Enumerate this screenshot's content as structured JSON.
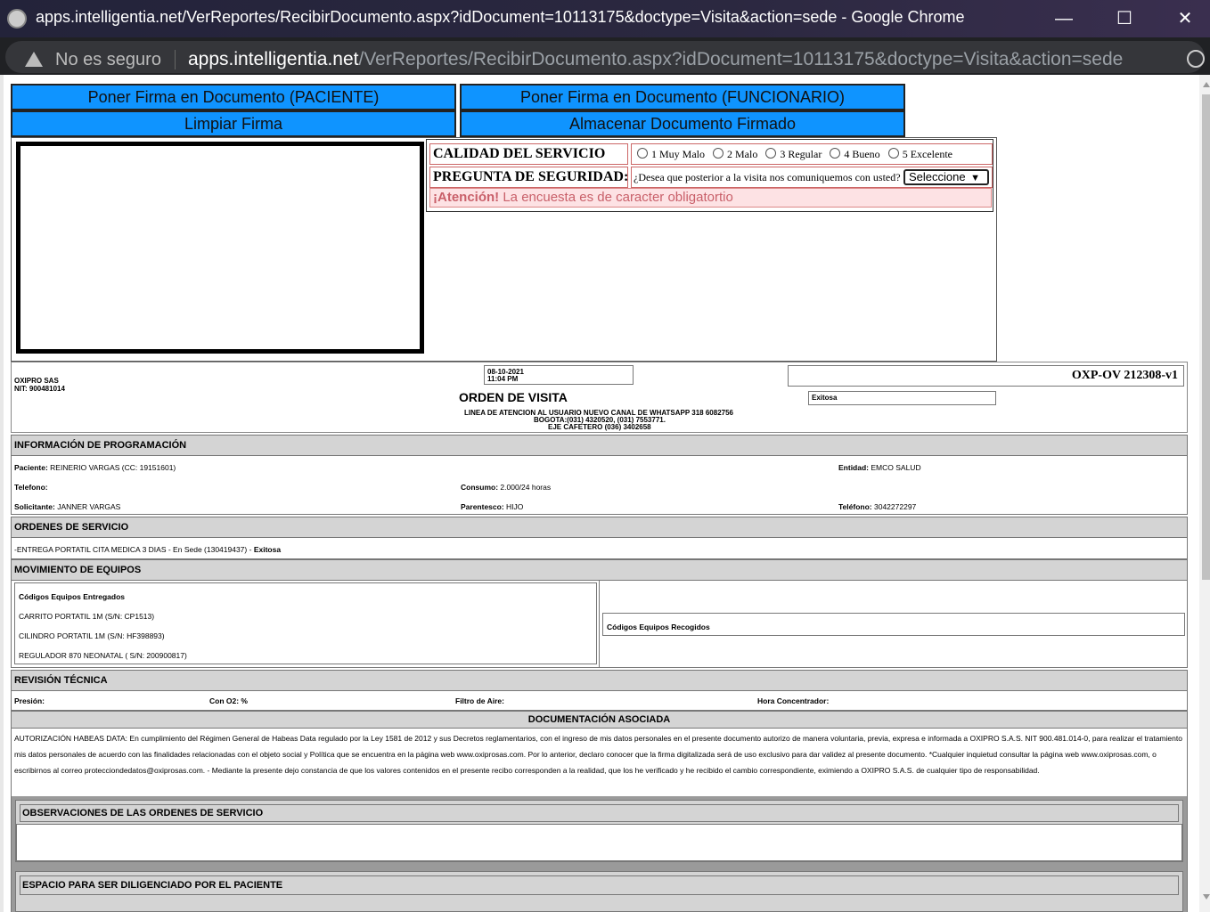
{
  "window": {
    "title": "apps.intelligentia.net/VerReportes/RecibirDocumento.aspx?idDocument=10113175&doctype=Visita&action=sede - Google Chrome",
    "minimize_icon": "minimize-icon",
    "maximize_icon": "maximize-icon",
    "close_icon": "close-icon"
  },
  "address": {
    "security_text": "No es seguro",
    "host": "apps.intelligentia.net",
    "path": "/VerReportes/RecibirDocumento.aspx?idDocument=10113175&doctype=Visita&action=sede"
  },
  "buttons": {
    "firma_paciente": "Poner Firma en Documento (PACIENTE)",
    "firma_funcionario": "Poner Firma en Documento (FUNCIONARIO)",
    "limpiar": "Limpiar Firma",
    "almacenar": "Almacenar Documento Firmado"
  },
  "survey": {
    "calidad_label": "CALIDAD DEL SERVICIO",
    "options": [
      "1 Muy Malo",
      "2 Malo",
      "3 Regular",
      "4 Bueno",
      "5 Excelente"
    ],
    "pregunta_label": "PREGUNTA DE SEGURIDAD:",
    "pregunta_text": "¿Desea que posterior a la visita nos comuniquemos con usted?",
    "select_value": "Seleccione",
    "alert_strong": "¡Atención!",
    "alert_text": " La encuesta es de caracter obligatortio"
  },
  "doc": {
    "company": "OXIPRO SAS",
    "nit": "NIT: 900481014",
    "date": "08-10-2021",
    "time": "11:04 PM",
    "title": "ORDEN DE VISITA",
    "line1": "LINEA DE ATENCION AL USUARIO NUEVO CANAL DE WHATSAPP 318 6082756",
    "line2": "BOGOTA:(031) 4320520, (031) 7553771.",
    "line3": "EJE CAFETERO (036) 3402658",
    "code": "OXP-OV 212308-v1",
    "status": "Exitosa"
  },
  "prog": {
    "header": "INFORMACIÓN DE PROGRAMACIÓN",
    "paciente_label": "Paciente:",
    "paciente": "REINERIO VARGAS (CC: 19151601)",
    "entidad_label": "Entidad:",
    "entidad": "EMCO SALUD",
    "telefono_label": "Telefono:",
    "consumo_label": "Consumo:",
    "consumo": "2.000/24 horas",
    "solicitante_label": "Solicitante:",
    "solicitante": "JANNER VARGAS",
    "parentesco_label": "Parentesco:",
    "parentesco": "HIJO",
    "telefono2_label": "Teléfono:",
    "telefono2": "3042272297"
  },
  "ordenes": {
    "header": "ORDENES DE SERVICIO",
    "item": "-ENTREGA PORTATIL CITA MEDICA 3 DIAS - En Sede (130419437)",
    "dash": "-",
    "status": "Exitosa"
  },
  "equipos": {
    "header": "MOVIMIENTO DE EQUIPOS",
    "entregados_label": "Códigos Equipos Entregados",
    "entregados": [
      "CARRITO PORTATIL 1M (S/N: CP1513)",
      "CILINDRO PORTATIL 1M (S/N: HF398893)",
      "REGULADOR 870 NEONATAL ( S/N: 200900817)"
    ],
    "recogidos_label": "Códigos Equipos Recogidos"
  },
  "revision": {
    "header": "REVISIÓN TÉCNICA",
    "presion": "Presión:",
    "con_o2": "Con O2: %",
    "filtro": "Filtro de Aire:",
    "hora": "Hora Concentrador:"
  },
  "documentacion": {
    "header": "DOCUMENTACIÓN ASOCIADA",
    "habeas": "AUTORIZACIÓN HABEAS DATA: En cumplimiento del Régimen General de Habeas Data regulado por la Ley 1581 de 2012 y sus Decretos reglamentarios, con el ingreso de mis datos personales en el presente documento autorizo de manera voluntaria, previa, expresa e informada a OXIPRO S.A.S. NIT 900.481.014-0, para realizar el tratamiento mis datos personales de acuerdo con las finalidades relacionadas con el objeto social y Política que se encuentra en la página web www.oxiprosas.com. Por lo anterior, declaro conocer que la firma digitalizada será de uso exclusivo para dar validez al presente documento. *Cualquier inquietud consultar la página web www.oxiprosas.com, o escribirnos al correo protecciondedatos@oxiprosas.com. - Mediante la presente dejo constancia de que los valores contenidos en el presente recibo corresponden a la realidad, que los he verificado y he recibido el cambio correspondiente, eximiendo a OXIPRO S.A.S. de cualquier tipo de responsabilidad."
  },
  "observaciones": {
    "header": "OBSERVACIONES DE LAS ORDENES DE SERVICIO"
  },
  "paciente_space": {
    "header": "ESPACIO PARA SER DILIGENCIADO POR EL PACIENTE"
  }
}
